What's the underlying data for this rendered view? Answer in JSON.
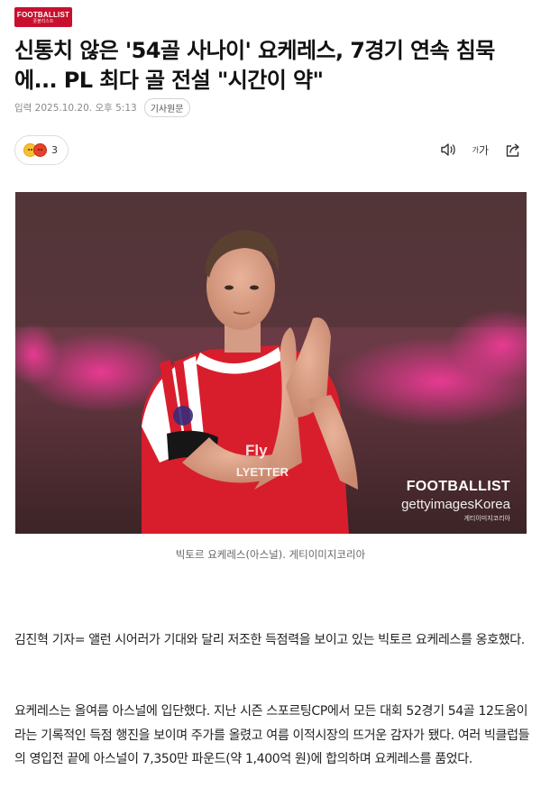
{
  "brand": {
    "name": "FOOTBALLIST",
    "subname": "풋볼리스트",
    "color": "#c8102e"
  },
  "article": {
    "headline": "신통치 않은 '54골 사나이' 요케레스, 7경기 연속 침묵에... PL 최다 골 전설 \"시간이 약\"",
    "date": "입력 2025.10.20. 오후 5:13",
    "source_button": "기사원문",
    "reaction_count": "3",
    "reaction_icons": [
      "sad-face-emoji",
      "angry-face-emoji"
    ],
    "tools": {
      "audio_icon": "speaker-icon",
      "font_label_small": "가",
      "font_label_large": "가",
      "share_icon": "share-icon"
    },
    "photo": {
      "watermark_brand": "FOOTBALLIST",
      "watermark_getty": "gettyimagesKorea",
      "watermark_credit": "게티이미지코리아"
    },
    "caption": "빅토르 요케레스(아스널). 게티이미지코리아",
    "paragraphs": [
      "김진혁 기자= 앨런 시어러가 기대와 달리 저조한 득점력을 보이고 있는 빅토르 요케레스를 옹호했다.",
      "요케레스는 올여름 아스널에 입단했다. 지난 시즌 스포르팅CP에서 모든 대회 52경기 54골 12도움이라는 기록적인 득점 행진을 보이며 주가를 올렸고 여름 이적시장의 뜨거운 감자가 됐다. 여러 빅클럽들의 영입전 끝에 아스널이 7,350만 파운드(약 1,400억 원)에 합의하며 요케레스를 품었다."
    ]
  }
}
